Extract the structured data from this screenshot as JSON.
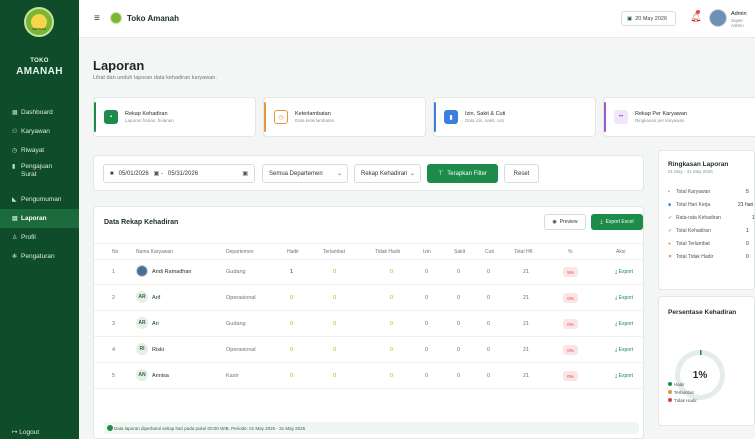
{
  "brand": {
    "logo_text": "AMANAH",
    "line1": "TOKO",
    "line2": "AMANAH",
    "store_name": "Toko Amanah"
  },
  "sidebar": {
    "items": [
      {
        "label": "Dashboard",
        "icon": "grid-icon"
      },
      {
        "label": "Karyawan",
        "icon": "users-icon"
      },
      {
        "label": "Riwayat",
        "icon": "history-icon"
      },
      {
        "label": "Pengajuan",
        "label2": "Surat",
        "icon": "document-icon"
      },
      {
        "label": "Pengumuman",
        "icon": "megaphone-icon"
      },
      {
        "label": "Laporan",
        "icon": "report-icon",
        "active": true
      },
      {
        "label": "Profil",
        "icon": "user-icon"
      },
      {
        "label": "Pengaturan",
        "icon": "gear-icon"
      }
    ],
    "logout": "Logout"
  },
  "topbar": {
    "date": "20 May 2026",
    "user_name": "Admin",
    "user_role": "Super Admin"
  },
  "page": {
    "title": "Laporan",
    "subtitle": "Lihat dan unduh laporan data kehadiran karyawan."
  },
  "tabs": [
    {
      "label": "Rekap Kehadiran",
      "sub": "Laporan harian, bulanan",
      "color": "#1d8b49"
    },
    {
      "label": "Keterlambatan",
      "sub": "Data keterlambatan",
      "color": "#e8963b"
    },
    {
      "label": "Izin, Sakit & Cuti",
      "sub": "Data izin, sakit, cuti",
      "color": "#3b7fe0"
    },
    {
      "label": "Rekap Per Karyawan",
      "sub": "Ringkasan per karyawan",
      "color": "#9b59d0"
    }
  ],
  "filter": {
    "date_range": "05/01/2026  ⟶  05/31/2026",
    "start_date": "05/01/2026",
    "end_date": "05/31/2026",
    "department": "Semua Departemen",
    "report_type": "Rekap Kehadiran",
    "apply": "Terapkan Filter",
    "reset": "Reset"
  },
  "table": {
    "title": "Data Rekap Kehadiran",
    "preview": "Preview",
    "export_excel": "Export Excel",
    "headers": [
      "No",
      "Nama Karyawan",
      "Departemen",
      "Hadir",
      "Terlambat",
      "Tidak Hadir",
      "Izin",
      "Sakit",
      "Cuti",
      "Total HK",
      "%",
      "Aksi"
    ],
    "rows": [
      {
        "no": "1",
        "initials": "",
        "name": "Andi Ramadhan",
        "dept": "Gudang",
        "hadir": "1",
        "terlambat": "0",
        "tidak_hadir": "0",
        "izin": "0",
        "sakit": "0",
        "cuti": "0",
        "total": "21",
        "pct": "5%",
        "aksi": "Export"
      },
      {
        "no": "2",
        "initials": "AR",
        "name": "Arif",
        "dept": "Operasional",
        "hadir": "0",
        "terlambat": "0",
        "tidak_hadir": "0",
        "izin": "0",
        "sakit": "0",
        "cuti": "0",
        "total": "21",
        "pct": "0%",
        "aksi": "Export"
      },
      {
        "no": "3",
        "initials": "AR",
        "name": "Ari",
        "dept": "Gudang",
        "hadir": "0",
        "terlambat": "0",
        "tidak_hadir": "0",
        "izin": "0",
        "sakit": "0",
        "cuti": "0",
        "total": "21",
        "pct": "0%",
        "aksi": "Export"
      },
      {
        "no": "4",
        "initials": "RI",
        "name": "Riski",
        "dept": "Operasional",
        "hadir": "0",
        "terlambat": "0",
        "tidak_hadir": "0",
        "izin": "0",
        "sakit": "0",
        "cuti": "0",
        "total": "21",
        "pct": "0%",
        "aksi": "Export"
      },
      {
        "no": "5",
        "initials": "AN",
        "name": "Annisa",
        "dept": "Kasir",
        "hadir": "0",
        "terlambat": "0",
        "tidak_hadir": "0",
        "izin": "0",
        "sakit": "0",
        "cuti": "0",
        "total": "21",
        "pct": "0%",
        "aksi": "Export"
      }
    ],
    "note": "Data laporan diperbarui setiap hari pada pukul 00:00 WIB. Periode: 01 May 2026 - 31 May 2026"
  },
  "summary": {
    "title": "Ringkasan Laporan",
    "period": "01 May - 31 May 2026",
    "items": [
      {
        "label": "Total Karyawan",
        "value": "5",
        "mark": "•",
        "color": "#7a8a80"
      },
      {
        "label": "Total Hari Kerja",
        "value": "21 hari",
        "mark": "■",
        "color": "#3b7fe0"
      },
      {
        "label": "Rata-rata Kehadiran",
        "value": "1%",
        "mark": "✓",
        "color": "#1d8b49"
      },
      {
        "label": "Total Kehadiran",
        "value": "1",
        "mark": "✓",
        "color": "#1d8b49"
      },
      {
        "label": "Total Terlambat",
        "value": "0",
        "mark": "●",
        "color": "#e8963b"
      },
      {
        "label": "Total Tidak Hadir",
        "value": "0",
        "mark": "✕",
        "color": "#d64545"
      }
    ]
  },
  "percentage": {
    "title": "Persentase Kehadiran",
    "value_label": "1%",
    "hadir_fraction": 0.01,
    "legend": [
      {
        "label": "Hadir",
        "color": "#1d8b49"
      },
      {
        "label": "Terlambat",
        "color": "#e8963b"
      },
      {
        "label": "Tidak Hadir",
        "color": "#d64545"
      }
    ]
  }
}
